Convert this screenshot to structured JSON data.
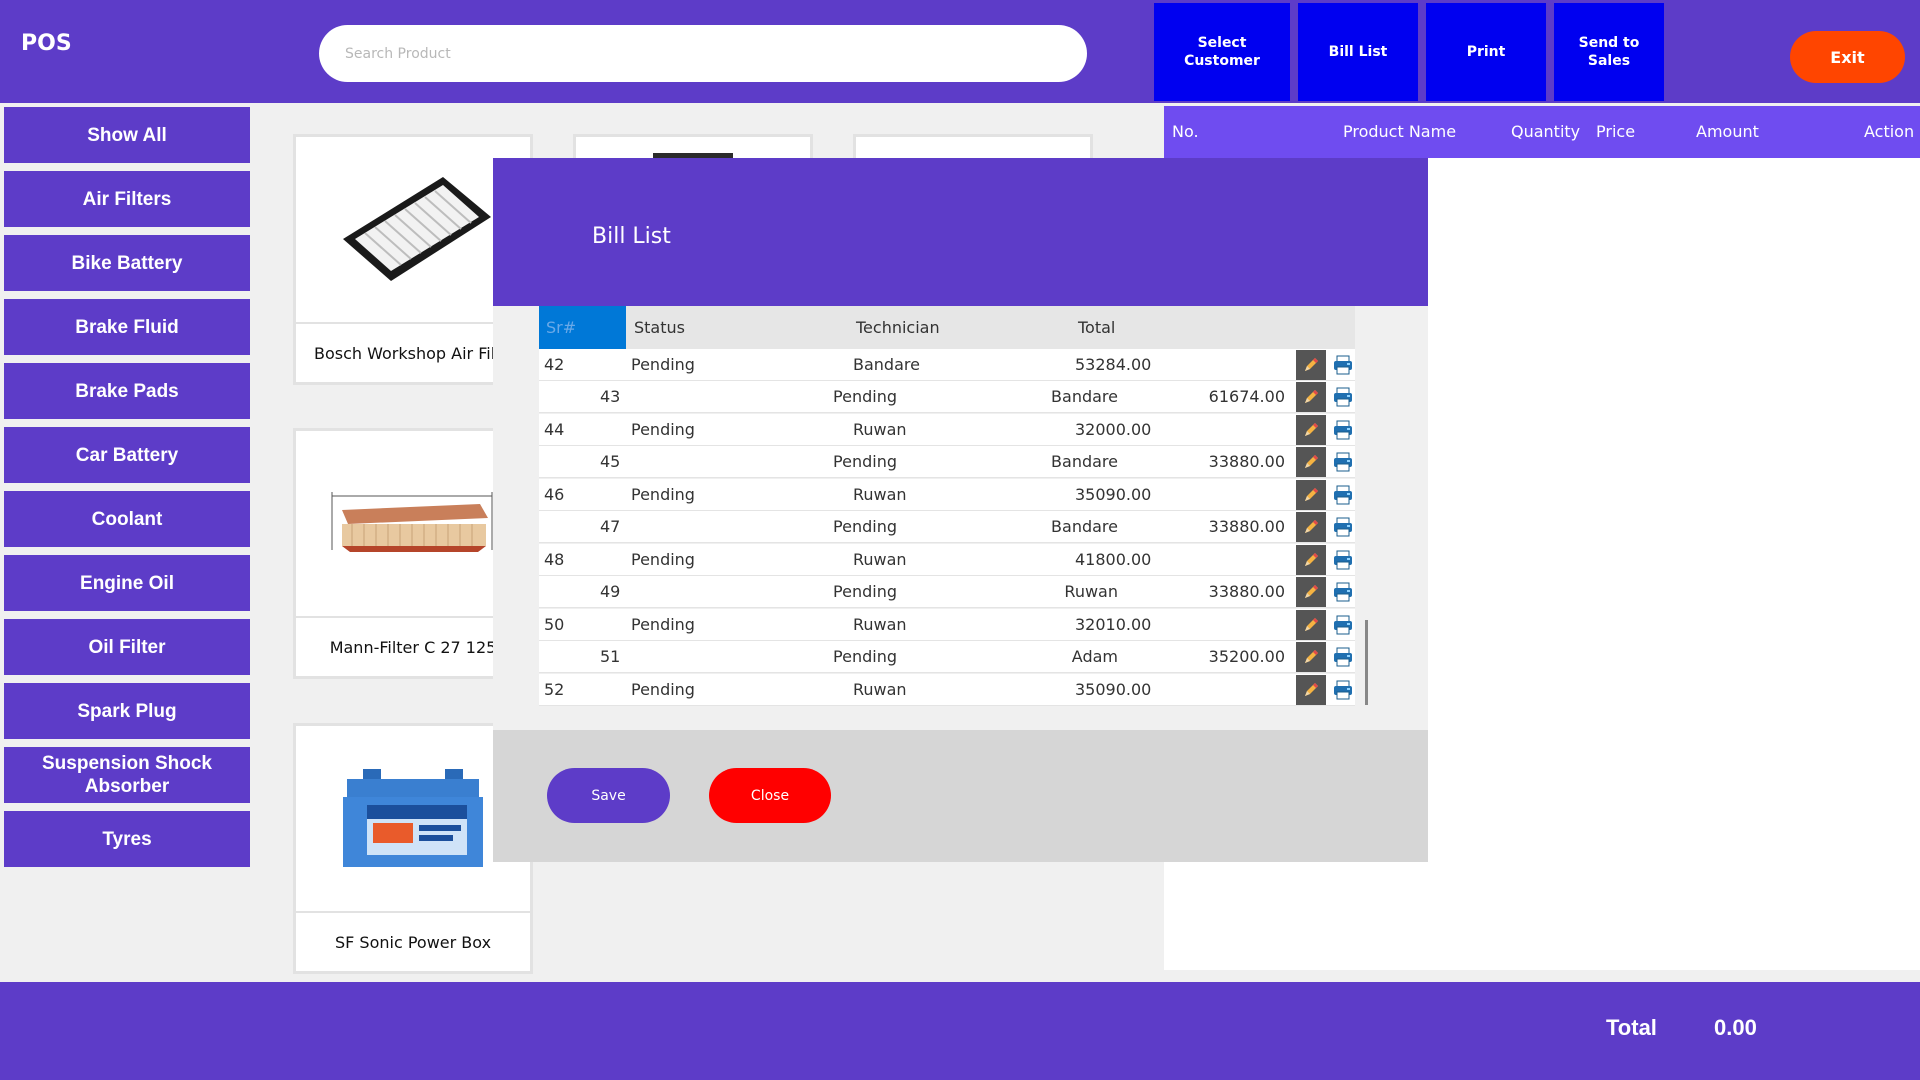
{
  "app": {
    "title": "POS"
  },
  "search": {
    "placeholder": "Search Product",
    "value": ""
  },
  "toolbar": {
    "select_customer": "Select\nCustomer",
    "bill_list": "Bill List",
    "print": "Print",
    "send_to_sales": "Send to\nSales",
    "exit": "Exit"
  },
  "categories": [
    "Show All",
    "Air Filters",
    "Bike Battery",
    "Brake Fluid",
    "Brake Pads",
    "Car Battery",
    "Coolant",
    "Engine Oil",
    "Oil Filter",
    "Spark Plug",
    "Suspension Shock Absorber",
    "Tyres"
  ],
  "products": [
    {
      "name": "Bosch Workshop Air Filter",
      "icon": "air-filter-panel-image"
    },
    {
      "name": "Mann-Filter C 27 125",
      "icon": "air-filter-cartridge-image"
    },
    {
      "name": "SF Sonic Power Box",
      "icon": "battery-image"
    }
  ],
  "cart": {
    "columns": [
      "No.",
      "Product Name",
      "Quantity",
      "Price",
      "Amount",
      "Action"
    ]
  },
  "footer": {
    "total_label": "Total",
    "total_value": "0.00"
  },
  "bill_modal": {
    "title": "Bill List",
    "columns": {
      "sr": "Sr#",
      "status": "Status",
      "technician": "Technician",
      "total": "Total"
    },
    "rows": [
      {
        "sr": "42",
        "status": "Pending",
        "technician": "Bandare",
        "total": "53284.00"
      },
      {
        "sr": "43",
        "status": "Pending",
        "technician": "Bandare",
        "total": "61674.00"
      },
      {
        "sr": "44",
        "status": "Pending",
        "technician": "Ruwan",
        "total": "32000.00"
      },
      {
        "sr": "45",
        "status": "Pending",
        "technician": "Bandare",
        "total": "33880.00"
      },
      {
        "sr": "46",
        "status": "Pending",
        "technician": "Ruwan",
        "total": "35090.00"
      },
      {
        "sr": "47",
        "status": "Pending",
        "technician": "Bandare",
        "total": "33880.00"
      },
      {
        "sr": "48",
        "status": "Pending",
        "technician": "Ruwan",
        "total": "41800.00"
      },
      {
        "sr": "49",
        "status": "Pending",
        "technician": "Ruwan",
        "total": "33880.00"
      },
      {
        "sr": "50",
        "status": "Pending",
        "technician": "Ruwan",
        "total": "32010.00"
      },
      {
        "sr": "51",
        "status": "Pending",
        "technician": "Adam",
        "total": "35200.00"
      },
      {
        "sr": "52",
        "status": "Pending",
        "technician": "Ruwan",
        "total": "35090.00"
      }
    ],
    "save_label": "Save",
    "close_label": "Close"
  }
}
